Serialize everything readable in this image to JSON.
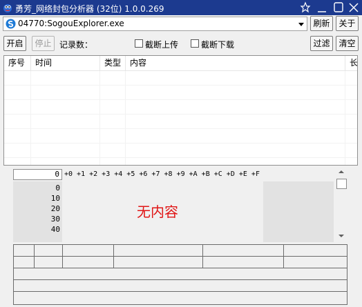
{
  "window": {
    "title": "勇芳_网络封包分析器 (32位) 1.0.0.269",
    "icon": "app-logo-icon",
    "controls": [
      "pin-icon",
      "minimize-icon",
      "maximize-icon",
      "close-icon"
    ]
  },
  "process": {
    "selected": "04770:SogouExplorer.exe",
    "icon": "sogou-browser-icon"
  },
  "toolbar": {
    "refresh_label": "刷新",
    "about_label": "关于",
    "start_label": "开启",
    "stop_label": "停止",
    "records_label": "记录数：",
    "records_value": "",
    "truncate_upload_label": "截断上传",
    "truncate_download_label": "截断下载",
    "truncate_upload_checked": false,
    "truncate_download_checked": false,
    "filter_label": "过滤",
    "clear_label": "清空"
  },
  "packet_list": {
    "columns": [
      "序号",
      "时间",
      "类型",
      "内容",
      "长"
    ],
    "rows": []
  },
  "hex_view": {
    "address": "0",
    "header": "+0 +1 +2 +3 +4 +5 +6 +7 +8 +9 +A +B +C +D +E +F",
    "offsets": [
      "0",
      "10",
      "20",
      "30",
      "40"
    ],
    "empty_message": "无内容",
    "empty_color": "#e01515"
  },
  "colors": {
    "titlebar": "#1c3a8f"
  }
}
